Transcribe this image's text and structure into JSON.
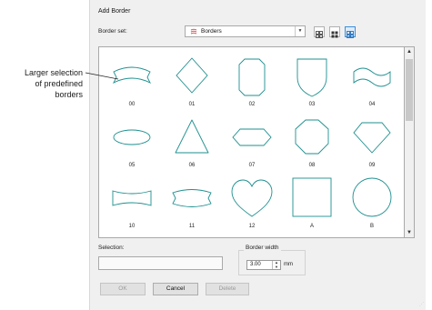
{
  "dialog": {
    "title": "Add Border",
    "border_set_label": "Border set:",
    "border_set_value": "Borders",
    "selection_label": "Selection:",
    "selection_value": "",
    "border_width_label": "Border width",
    "border_width_value": "3.00",
    "border_width_unit": "mm",
    "buttons": {
      "ok": "OK",
      "cancel": "Cancel",
      "delete": "Delete"
    }
  },
  "borders": [
    "00",
    "01",
    "02",
    "03",
    "04",
    "05",
    "06",
    "07",
    "08",
    "09",
    "10",
    "11",
    "12",
    "A",
    "B"
  ],
  "annotation": {
    "line1": "Larger selection",
    "line2": "of predefined",
    "line3": "borders"
  },
  "colors": {
    "shape_stroke": "#1d8f8f",
    "accent": "#3c8fd8",
    "brand_icon": "#e2504f"
  },
  "icons": {
    "border_set": "borders-icon",
    "view_small": "small-thumbnails-icon",
    "view_list": "list-view-icon",
    "view_large": "large-thumbnails-icon",
    "dropdown": "chevron-down-icon",
    "scroll_up": "chevron-up-icon",
    "scroll_down": "chevron-down-icon",
    "spin": "spinner-arrows-icon"
  }
}
